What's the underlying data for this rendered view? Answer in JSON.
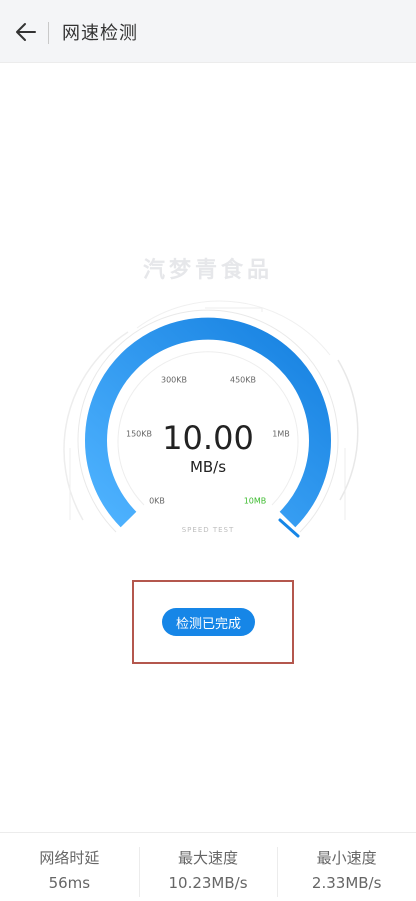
{
  "header": {
    "title": "网速检测",
    "back_icon": "arrow-left-icon"
  },
  "watermark": "汽梦青食品",
  "gauge": {
    "value": "10.00",
    "unit": "MB/s",
    "caption": "SPEED TEST",
    "ticks": [
      "0KB",
      "150KB",
      "300KB",
      "450KB",
      "1MB",
      "10MB"
    ],
    "active_tick": "10MB",
    "fill_fraction": 1.0,
    "accent_color": "#1686e7",
    "active_tick_color": "#3dbb2f"
  },
  "status_button": {
    "label": "检测已完成"
  },
  "stats": [
    {
      "label": "网络时延",
      "value": "56ms"
    },
    {
      "label": "最大速度",
      "value": "10.23MB/s"
    },
    {
      "label": "最小速度",
      "value": "2.33MB/s"
    }
  ]
}
